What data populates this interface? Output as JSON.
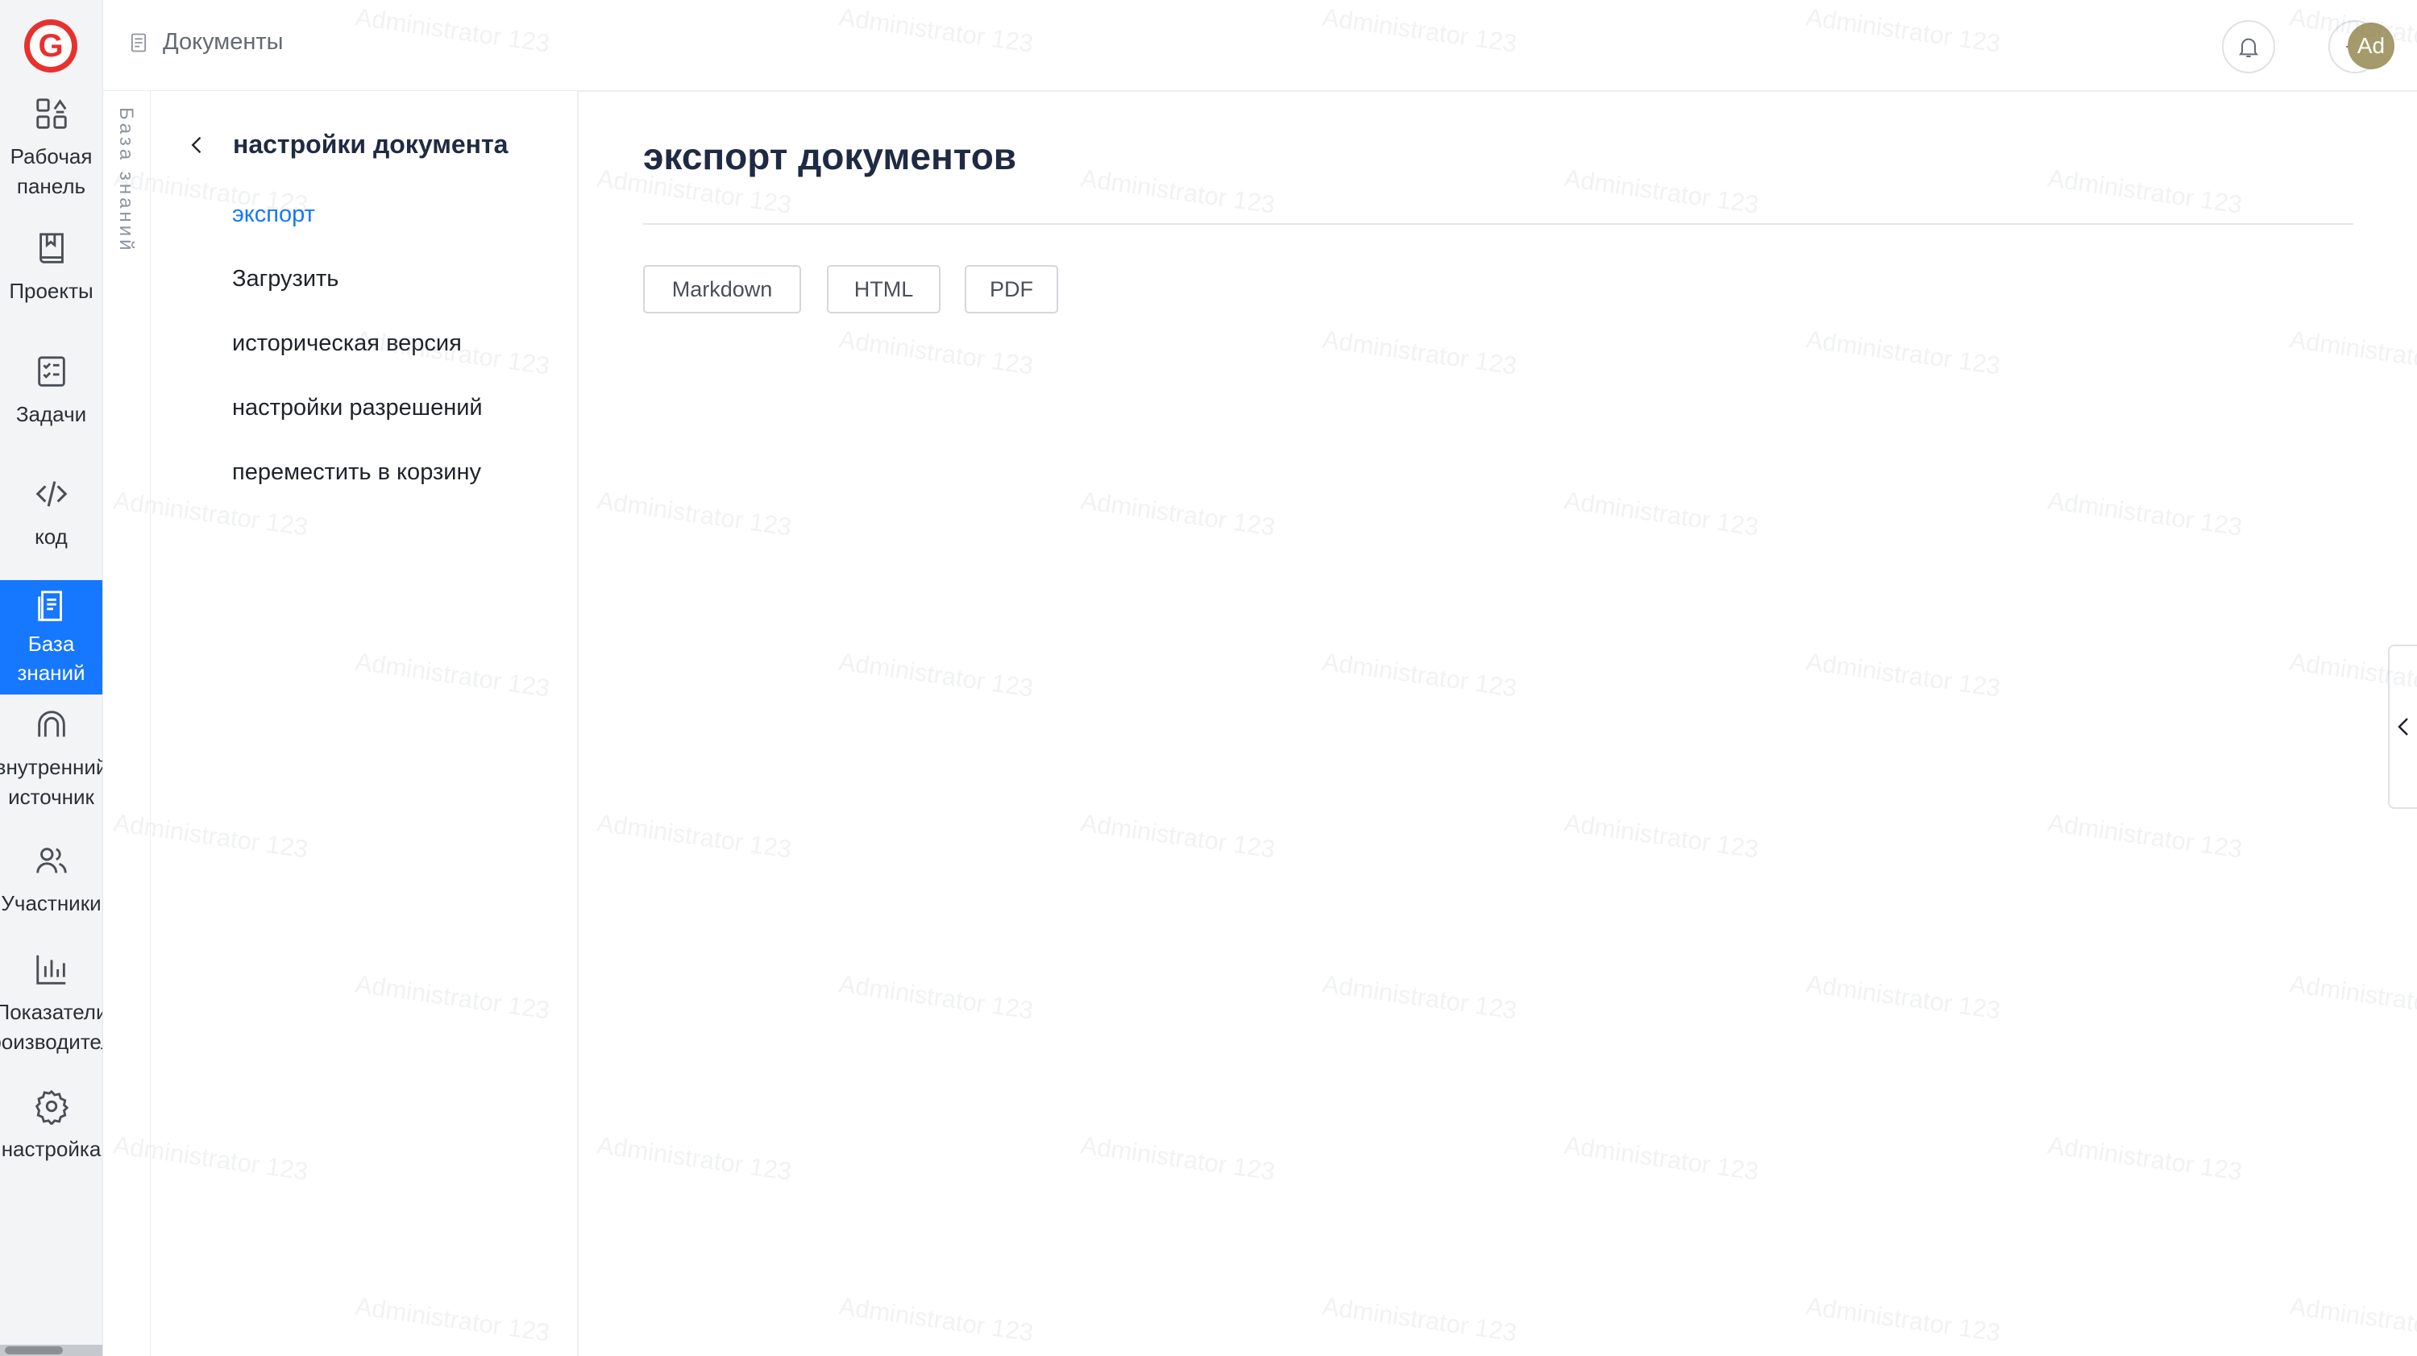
{
  "rail": {
    "logo_letter": "G",
    "items": [
      {
        "label": "Рабочая\nпанель",
        "icon": "dashboard-icon"
      },
      {
        "label": "Проекты",
        "icon": "project-book-icon"
      },
      {
        "label": "Задачи",
        "icon": "task-checklist-icon"
      },
      {
        "label": "код",
        "icon": "code-icon"
      },
      {
        "label": "База\nзнаний",
        "icon": "knowledge-base-icon"
      },
      {
        "label": "внутренний\nисточник",
        "icon": "inner-source-icon"
      },
      {
        "label": "Участники",
        "icon": "members-icon"
      },
      {
        "label": "Показатели\nпроизводитель",
        "icon": "metrics-chart-icon"
      },
      {
        "label": "настройка",
        "icon": "gear-icon"
      }
    ],
    "active_index": 4
  },
  "header": {
    "breadcrumb": "Документы",
    "avatar": "Ad"
  },
  "kb_strip": {
    "label": "База знаний"
  },
  "sidebar": {
    "title": "настройки документа",
    "items": [
      "экспорт",
      "Загрузить",
      "историческая версия",
      "настройки разрешений",
      "переместить в корзину"
    ],
    "active_index": 0
  },
  "main": {
    "title": "экспорт документов",
    "buttons": [
      "Markdown",
      "HTML",
      "PDF"
    ]
  },
  "watermark": "Administrator 123",
  "colors": {
    "accent": "#1677ff",
    "logo": "#e8312f",
    "avatar": "#a49a6a"
  }
}
